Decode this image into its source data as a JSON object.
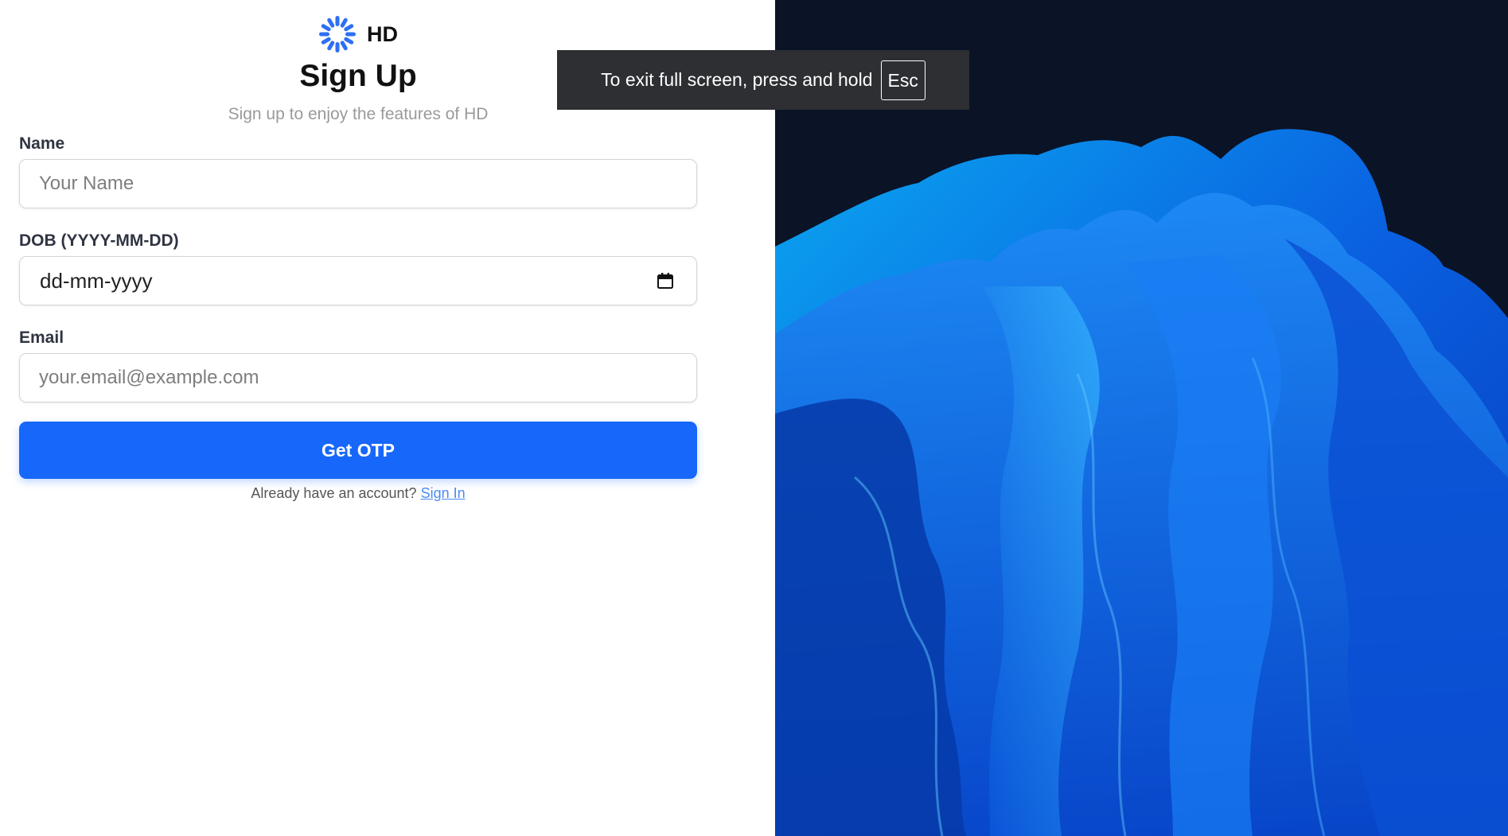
{
  "brand": {
    "name": "HD",
    "logo_icon": "sun-burst-icon",
    "accent_color": "#1767fb"
  },
  "signup": {
    "title": "Sign Up",
    "subtitle": "Sign up to enjoy the features of HD"
  },
  "form": {
    "name": {
      "label": "Name",
      "placeholder": "Your Name",
      "value": ""
    },
    "dob": {
      "label": "DOB (YYYY-MM-DD)",
      "display_value": "dd-mm-yyyy",
      "icon": "calendar-icon"
    },
    "email": {
      "label": "Email",
      "placeholder": "your.email@example.com",
      "value": ""
    },
    "submit_label": "Get OTP"
  },
  "signin": {
    "prompt": "Already have an account?",
    "link_label": "Sign In"
  },
  "fullscreen_notice": {
    "text": "To exit full screen, press and hold",
    "key": "Esc"
  },
  "background": {
    "description_color": "#1565e8"
  }
}
